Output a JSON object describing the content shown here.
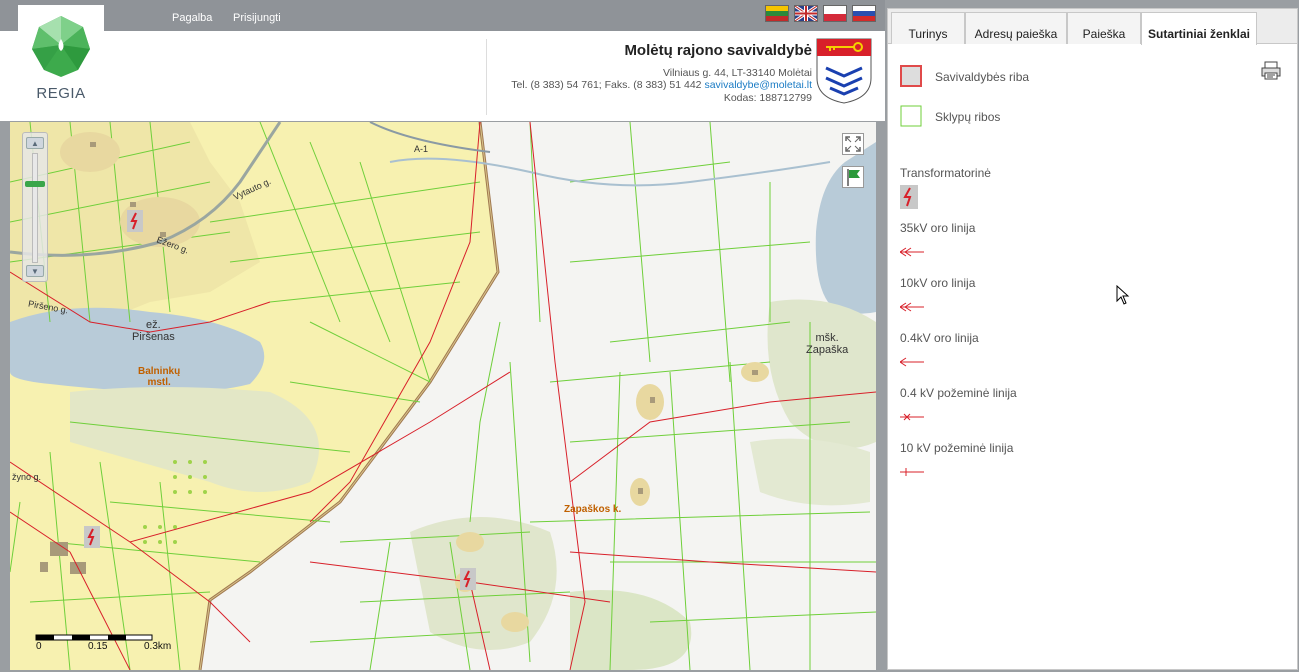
{
  "topbar": {
    "links": [
      "Pagalba",
      "Prisijungti"
    ],
    "languages": [
      "lithuanian-flag",
      "uk-flag",
      "polish-flag",
      "russian-flag"
    ]
  },
  "logo": {
    "text": "REGIA"
  },
  "municipality": {
    "name": "Molėtų rajono savivaldybė",
    "address": "Vilniaus g. 44, LT-33140 Molėtai",
    "phones": "Tel. (8 383) 54 761; Faks. (8 383) 51 442",
    "email": "savivaldybe@moletai.lt",
    "code": "Kodas: 188712799"
  },
  "map": {
    "labels": {
      "lake": "ež. Piršenas",
      "lake_line1": "ež.",
      "lake_line2": "Piršenas",
      "mstl_line1": "Balninkų",
      "mstl_line2": "mstl.",
      "village_line1": "mšk.",
      "village_line2": "Zapaška",
      "zapaskos": "Zapaškos k.",
      "road_a1": "A-1",
      "street_vytauto": "Vytauto g.",
      "street_ezero": "Ežero g.",
      "street_pirseno": "Piršeno g.",
      "street_zyno": "žyno g."
    },
    "scale": {
      "labels": [
        "0",
        "0.15",
        "0.3km"
      ]
    },
    "tools": [
      "fullscreen-icon",
      "flag-icon"
    ]
  },
  "panel": {
    "tabs": [
      "Turinys",
      "Adresų paieška",
      "Paieška",
      "Sutartiniai ženklai"
    ],
    "active_tab": "Sutartiniai ženklai",
    "legend": [
      {
        "label": "Savivaldybės riba",
        "icon": "municipality-boundary-icon"
      },
      {
        "label": "Sklypų ribos",
        "icon": "parcel-boundary-icon"
      },
      {
        "label": "Transformatorinė",
        "icon": "transformer-icon"
      },
      {
        "label": "35kV oro linija",
        "icon": "line-35kv-icon"
      },
      {
        "label": "10kV oro linija",
        "icon": "line-10kv-icon"
      },
      {
        "label": "0.4kV oro linija",
        "icon": "line-04kv-icon"
      },
      {
        "label": "0.4 kV požeminė linija",
        "icon": "underground-04kv-icon"
      },
      {
        "label": "10 kV požeminė linija",
        "icon": "underground-10kv-icon"
      }
    ]
  },
  "colors": {
    "municipality_fill": "#f7f1b0",
    "parcel_line": "#6fcf3a",
    "power_line": "#d8202a",
    "water": "#b8cbd8",
    "boundary": "#a07850"
  }
}
